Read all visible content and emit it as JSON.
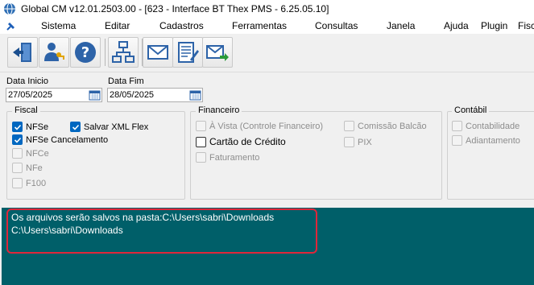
{
  "window": {
    "title": "Global CM v12.01.2503.00 - [623 - Interface BT Thex PMS - 6.25.05.10]"
  },
  "menu": {
    "items": [
      "Sistema",
      "Editar",
      "Cadastros",
      "Ferramentas",
      "Consultas",
      "Janela",
      "Ajuda",
      "Plugin",
      "Fiscal"
    ]
  },
  "toolbar": {
    "buttons": [
      {
        "icon": "exit-door-icon"
      },
      {
        "icon": "user-key-icon"
      },
      {
        "icon": "help-icon"
      },
      {
        "icon": "network-diagram-icon"
      },
      {
        "icon": "email-icon"
      },
      {
        "icon": "form-edit-icon"
      },
      {
        "icon": "email-forward-icon"
      }
    ]
  },
  "filters": {
    "data_inicio": {
      "label": "Data Inicio",
      "value": "27/05/2025"
    },
    "data_fim": {
      "label": "Data Fim",
      "value": "28/05/2025"
    }
  },
  "fiscal": {
    "title": "Fiscal",
    "items": [
      {
        "label": "NFSe",
        "checked": true,
        "enabled": true
      },
      {
        "label": "Salvar XML Flex",
        "checked": true,
        "enabled": true
      },
      {
        "label": "NFSe Cancelamento",
        "checked": true,
        "enabled": true
      },
      {
        "label": "NFCe",
        "checked": false,
        "enabled": false
      },
      {
        "label": "NFe",
        "checked": false,
        "enabled": false
      },
      {
        "label": "F100",
        "checked": false,
        "enabled": false
      }
    ]
  },
  "financeiro": {
    "title": "Financeiro",
    "items": [
      {
        "label": "À Vista (Controle Financeiro)",
        "checked": false,
        "enabled": false
      },
      {
        "label": "Comissão Balcão",
        "checked": false,
        "enabled": false
      },
      {
        "label": "Cartão de Crédito",
        "checked": false,
        "enabled": true
      },
      {
        "label": "PIX",
        "checked": false,
        "enabled": false
      },
      {
        "label": "Faturamento",
        "checked": false,
        "enabled": false
      }
    ]
  },
  "contabil": {
    "title": "Contábil",
    "items": [
      {
        "label": "Contabilidade",
        "checked": false,
        "enabled": false
      },
      {
        "label": "Adiantamento",
        "checked": false,
        "enabled": false
      }
    ]
  },
  "log": {
    "lines": [
      "Os arquivos serão salvos na pasta:C:\\Users\\sabri\\Downloads",
      "C:\\Users\\sabri\\Downloads"
    ]
  },
  "colors": {
    "log_background": "#005f69",
    "highlight_border": "#e0263a",
    "checkbox_checked": "#0067c0"
  }
}
